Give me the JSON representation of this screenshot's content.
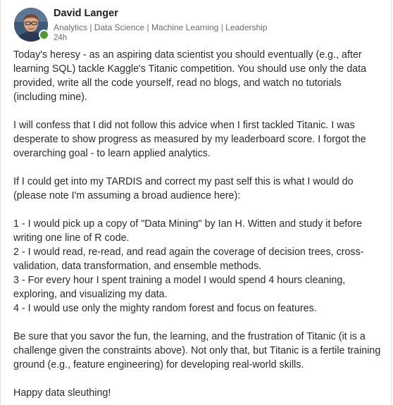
{
  "post": {
    "author": {
      "name": "David Langer",
      "headline": "Analytics | Data Science | Machine Learning | Leadership",
      "time": "24h",
      "online_color": "#4f9a2f"
    },
    "paragraphs": [
      "Today's heresy - as an aspiring data scientist you should eventually (e.g., after learning SQL) tackle Kaggle's Titanic competition. You should use only the data provided, write all the code yourself, read no blogs, and watch no tutorials (including mine).",
      "I will confess that I did not follow this advice when I first tackled Titanic. I was desperate to show progress as measured by my leaderboard score. I forgot the overarching goal - to learn applied analytics.",
      "If I could get into my TARDIS and correct my past self this is what I would do (please note I'm assuming a broad audience here):"
    ],
    "list_items": [
      "1 -  I would pick up a copy of \"Data Mining\" by Ian H. Witten and study it before writing one line of R code.",
      "2 - I would read, re-read, and read again the coverage of decision trees, cross-validation, data transformation, and ensemble methods.",
      "3 - For every hour I spent training a model I would spend 4 hours cleaning, exploring, and visualizing my data.",
      "4 - I would use only the mighty random forest and focus on features."
    ],
    "closing_paragraph": "Be sure that you savor the fun, the learning, and the frustration of Titanic (it is a challenge given the constraints above). Not only that, but Titanic is a fertile training ground (e.g., feature engineering) for developing real-world skills.",
    "sign_off": "Happy data sleuthing!"
  }
}
